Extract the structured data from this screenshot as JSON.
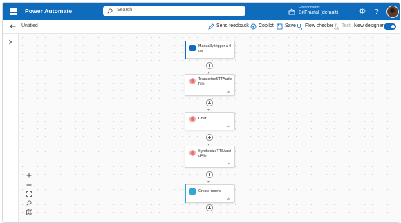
{
  "header": {
    "app_title": "Power Automate",
    "search_placeholder": "Search",
    "environment_label": "Environments",
    "environment_name": "BitFractal (default)"
  },
  "cmdbar": {
    "flow_name": "Untitled",
    "send_feedback": "Send feedback",
    "copilot": "Copilot",
    "save": "Save",
    "flow_checker": "Flow checker",
    "test": "Test",
    "new_designer": "New designer",
    "new_designer_on": true
  },
  "flow": {
    "steps": [
      {
        "title": "Manually trigger a flow",
        "kind": "trigger"
      },
      {
        "title": "TranscribeSTTAudioFile",
        "kind": "ai"
      },
      {
        "title": "Chat",
        "kind": "ai"
      },
      {
        "title": "SynthesizeTTSAudioFile",
        "kind": "ai"
      },
      {
        "title": "Create record",
        "kind": "dataverse"
      }
    ]
  },
  "colors": {
    "brand": "#0f6cbd",
    "ai_icon": "#e07070",
    "dataverse_icon": "#31a6d8"
  }
}
